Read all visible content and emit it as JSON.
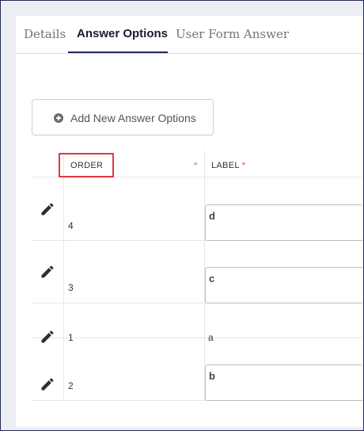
{
  "tabs": [
    {
      "label": "Details",
      "active": false
    },
    {
      "label": "Answer Options",
      "active": true
    },
    {
      "label": "User Form Answer",
      "active": false
    }
  ],
  "add_button": {
    "label": "Add New Answer Options",
    "icon": "plus-circle-icon"
  },
  "table": {
    "columns": [
      {
        "label": "ORDER",
        "sortable": true,
        "highlighted": true
      },
      {
        "label": "LABEL",
        "required_marker": "*"
      }
    ],
    "rows": [
      {
        "order": "4",
        "label": "d",
        "editing": true
      },
      {
        "order": "3",
        "label": "c",
        "editing": true
      },
      {
        "order": "1",
        "label": "a",
        "editing": false
      },
      {
        "order": "2",
        "label": "b",
        "editing": true
      }
    ]
  },
  "colors": {
    "accent": "#1f2a5a",
    "highlight_border": "#e0393e",
    "required": "#e53935",
    "page_background": "#ededf4"
  }
}
